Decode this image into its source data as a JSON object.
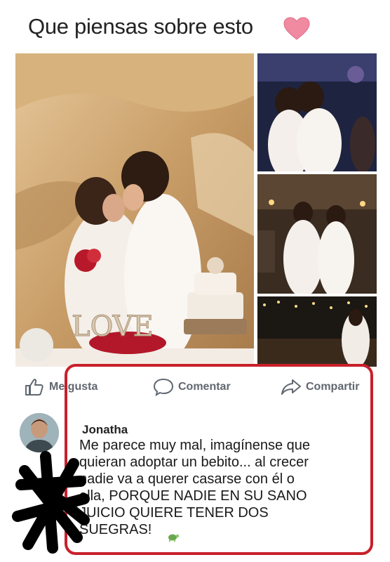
{
  "post": {
    "title": "Que piensas sobre esto",
    "photo_decor_text": "LOVE",
    "actions": {
      "like": "Me gusta",
      "comment": "Comentar",
      "share": "Compartir"
    }
  },
  "comment": {
    "author": "Jonatha",
    "text": "Me parece muy mal, imagínense que\nquieran adoptar un bebito... al crecer\nnadie va a querer casarse con él o\nella, PORQUE NADIE EN SU SANO\nJUICIO QUIERE TENER DOS\nSUEGRAS!"
  },
  "colors": {
    "heart": "#f08aa0",
    "highlight": "#c8202a",
    "action_text": "#606770"
  },
  "icons": [
    "heart-icon",
    "thumbs-up-icon",
    "comment-icon",
    "share-icon",
    "turtle-emoji-icon"
  ]
}
